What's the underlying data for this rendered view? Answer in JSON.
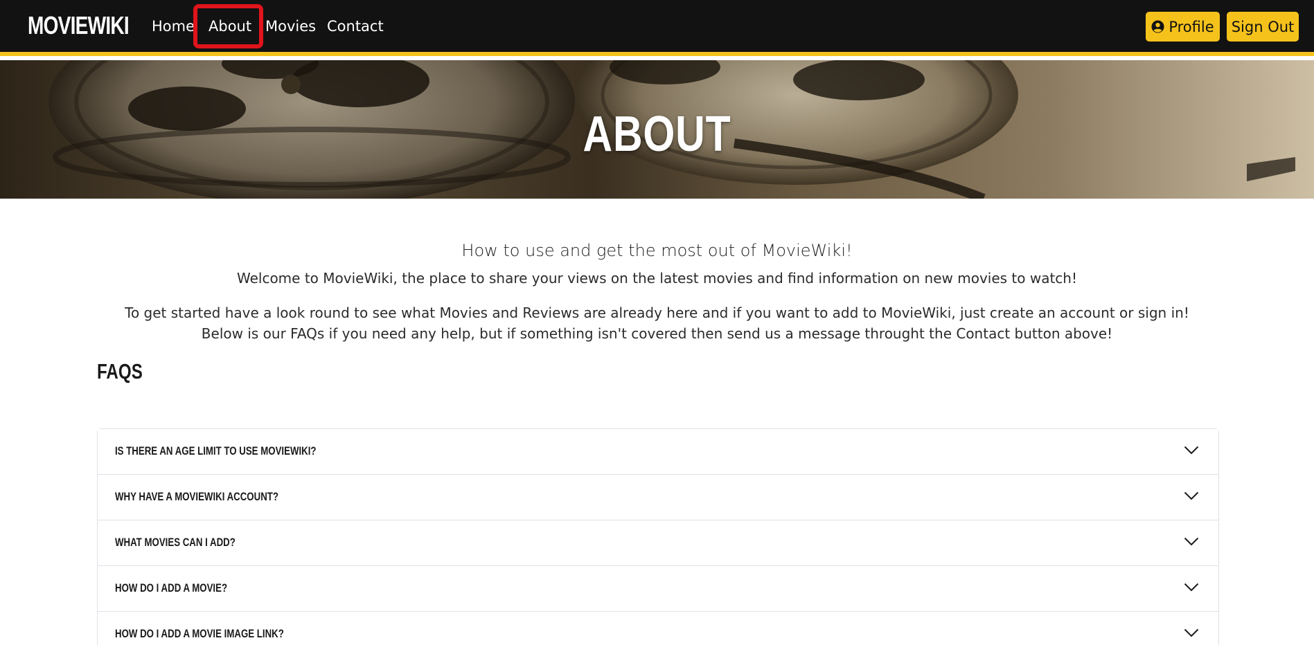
{
  "navbar": {
    "brand": "MOVIEWIKI",
    "links": [
      "Home",
      "About",
      "Movies",
      "Contact"
    ],
    "active": "About",
    "profile_label": "Profile",
    "signout_label": "Sign Out",
    "accent_color": "#f5c21c",
    "highlight_color": "#e0141c"
  },
  "hero": {
    "title": "ABOUT"
  },
  "intro": {
    "heading": "How to use and get the most out of MovieWiki!",
    "welcome": "Welcome to MovieWiki, the place to share your views on the latest movies and find information on new movies to watch!",
    "start": "To get started have a look round to see what Movies and Reviews are already here and if you want to add to MovieWiki, just create an account or sign in!",
    "below": "Below is our FAQs if you need any help, but if something isn't covered then send us a message throught the Contact button above!"
  },
  "faqs": {
    "title": "FAQS",
    "items": [
      "Is there an age limit to use MovieWiki?",
      "Why have a MovieWiki account?",
      "What movies can I add?",
      "How do I add a movie?",
      "How do I add a movie image link?"
    ]
  },
  "icons": {
    "user": "user-circle-icon",
    "chevron": "chevron-down-icon"
  }
}
